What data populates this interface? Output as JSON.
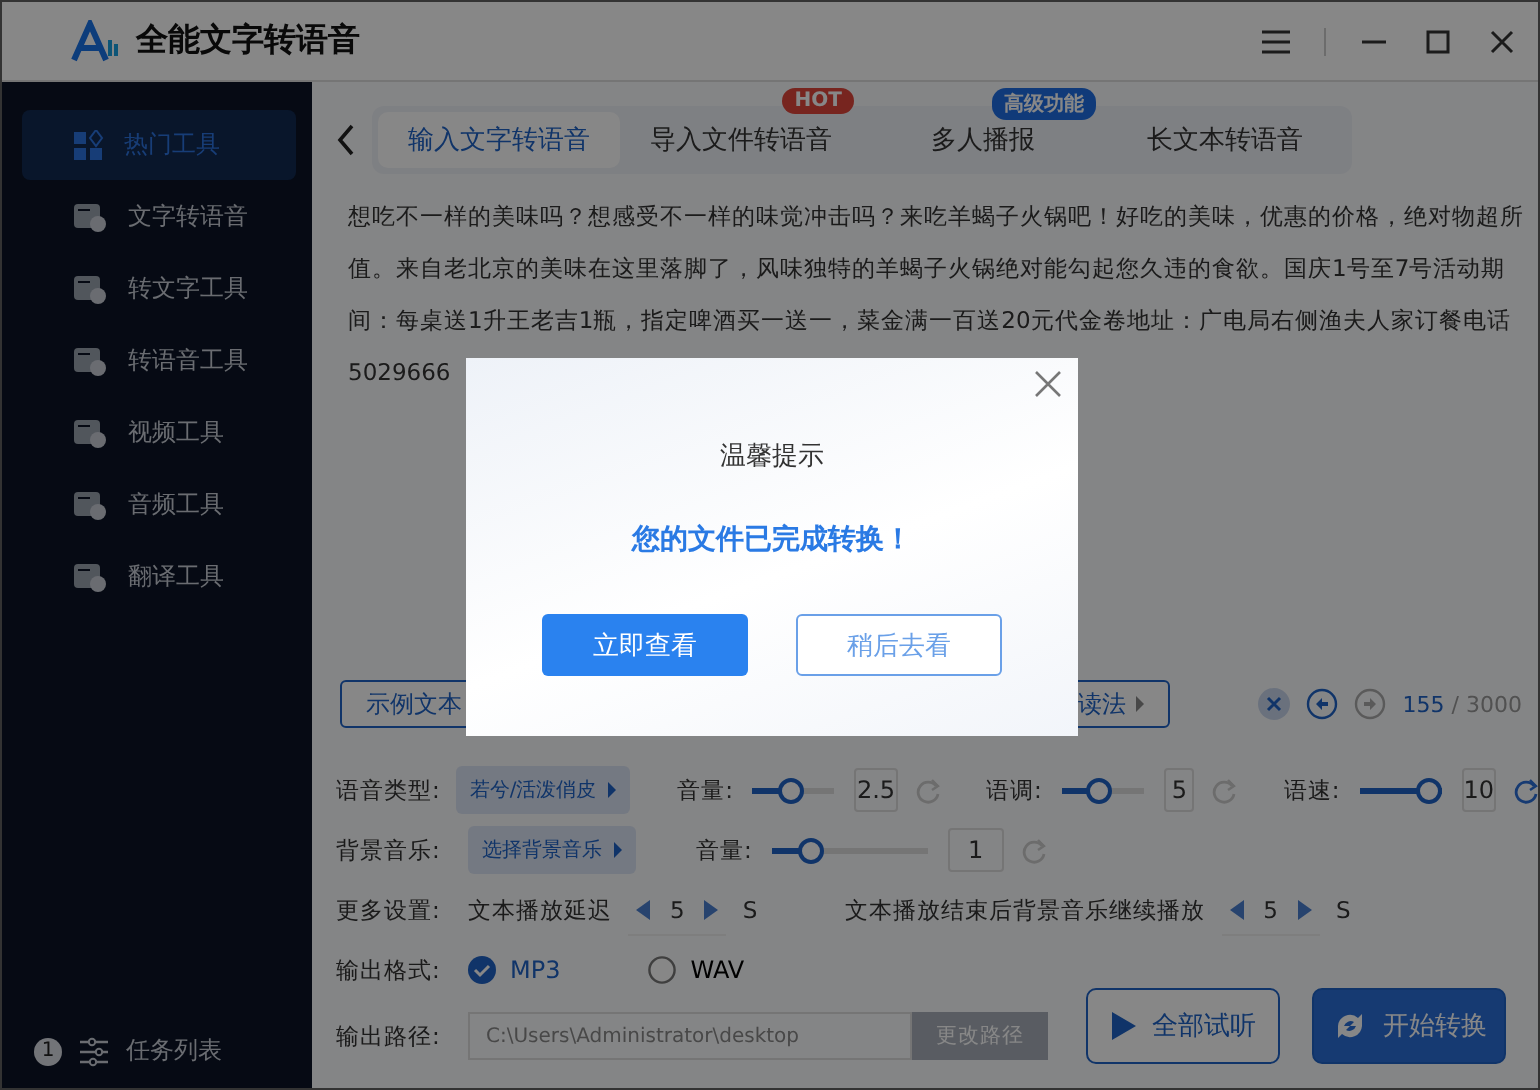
{
  "window": {
    "title": "全能文字转语音"
  },
  "sidebar": {
    "items": [
      {
        "label": "热门工具",
        "selected": true
      },
      {
        "label": "文字转语音",
        "selected": false
      },
      {
        "label": "转文字工具",
        "selected": false
      },
      {
        "label": "转语音工具",
        "selected": false
      },
      {
        "label": "视频工具",
        "selected": false
      },
      {
        "label": "音频工具",
        "selected": false
      },
      {
        "label": "翻译工具",
        "selected": false
      }
    ],
    "footer": {
      "badge": "1",
      "label": "任务列表"
    }
  },
  "tabs": [
    {
      "label": "输入文字转语音",
      "selected": true
    },
    {
      "label": "导入文件转语音",
      "selected": false,
      "badge": {
        "text": "HOT",
        "kind": "hot"
      }
    },
    {
      "label": "多人播报",
      "selected": false,
      "badge": {
        "text": "高级功能",
        "kind": "premium"
      }
    },
    {
      "label": "长文本转语音",
      "selected": false
    }
  ],
  "editor": {
    "text": "想吃不一样的美味吗？想感受不一样的味觉冲击吗？来吃羊蝎子火锅吧！好吃的美味，优惠的价格，绝对物超所值。来自老北京的美味在这里落脚了，风味独特的羊蝎子火锅绝对能勾起您久违的食欲。国庆1号至7号活动期间：每桌送1升王老吉1瓶，指定啤酒买一送一，菜金满一百送20元代金卷地址：广电局右侧渔夫人家订餐电话5029666",
    "buttons": [
      "示例文本",
      "读法"
    ],
    "count": "155",
    "limit": "/ 3000"
  },
  "settings": {
    "voice": {
      "label": "语音类型:",
      "value": "若兮/活泼俏皮",
      "sliders": [
        {
          "label": "音量:",
          "level": 0.45,
          "value": "2.5",
          "reset_enabled": false
        },
        {
          "label": "语调:",
          "level": 0.45,
          "value": "5",
          "reset_enabled": false
        },
        {
          "label": "语速:",
          "level": 1.0,
          "value": "10",
          "reset_enabled": true
        }
      ]
    },
    "music": {
      "label": "背景音乐:",
      "value": "选择背景音乐",
      "sliders": [
        {
          "label": "音量:",
          "level": 0.2,
          "value": "1",
          "reset_enabled": false
        }
      ]
    },
    "more": {
      "label": "更多设置:",
      "steppers": [
        {
          "label": "文本播放延迟",
          "value": "5",
          "unit": "S"
        },
        {
          "label": "文本播放结束后背景音乐继续播放",
          "value": "5",
          "unit": "S"
        }
      ]
    },
    "format": {
      "label": "输出格式:",
      "options": [
        {
          "label": "MP3",
          "selected": true
        },
        {
          "label": "WAV",
          "selected": false
        }
      ]
    },
    "path": {
      "label": "输出路径:",
      "value": "C:\\Users\\Administrator\\desktop",
      "button": "更改路径"
    },
    "actions": [
      {
        "label": "全部试听",
        "kind": "outline"
      },
      {
        "label": "开始转换",
        "kind": "primary"
      }
    ]
  },
  "dialog": {
    "title": "温馨提示",
    "message": "您的文件已完成转换！",
    "buttons": [
      {
        "label": "立即查看",
        "kind": "primary"
      },
      {
        "label": "稍后去看",
        "kind": "outline"
      }
    ]
  }
}
